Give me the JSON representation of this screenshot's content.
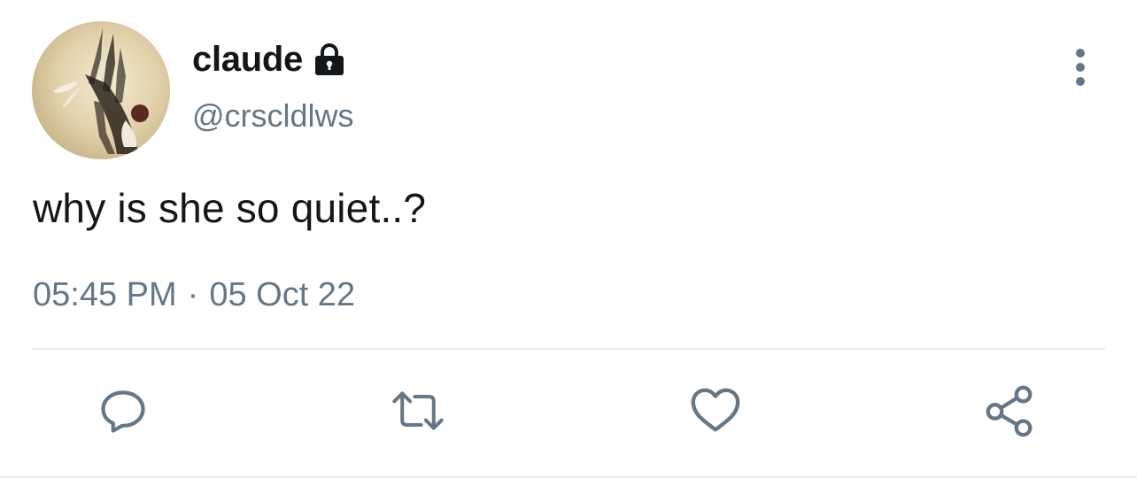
{
  "user": {
    "display_name": "claude",
    "handle": "@crscldlws",
    "protected": true,
    "avatar_icon": "avatar-image"
  },
  "tweet": {
    "text": "why is she so quiet..?",
    "time": "05:45 PM",
    "separator": "·",
    "date": "05 Oct 22"
  },
  "actions": [
    {
      "name": "reply",
      "icon": "speech-bubble-icon"
    },
    {
      "name": "retweet",
      "icon": "retweet-icon"
    },
    {
      "name": "like",
      "icon": "heart-icon"
    },
    {
      "name": "share",
      "icon": "share-icon"
    }
  ],
  "colors": {
    "text": "#14171a",
    "secondary": "#657786",
    "divider": "#e1e8ed"
  }
}
